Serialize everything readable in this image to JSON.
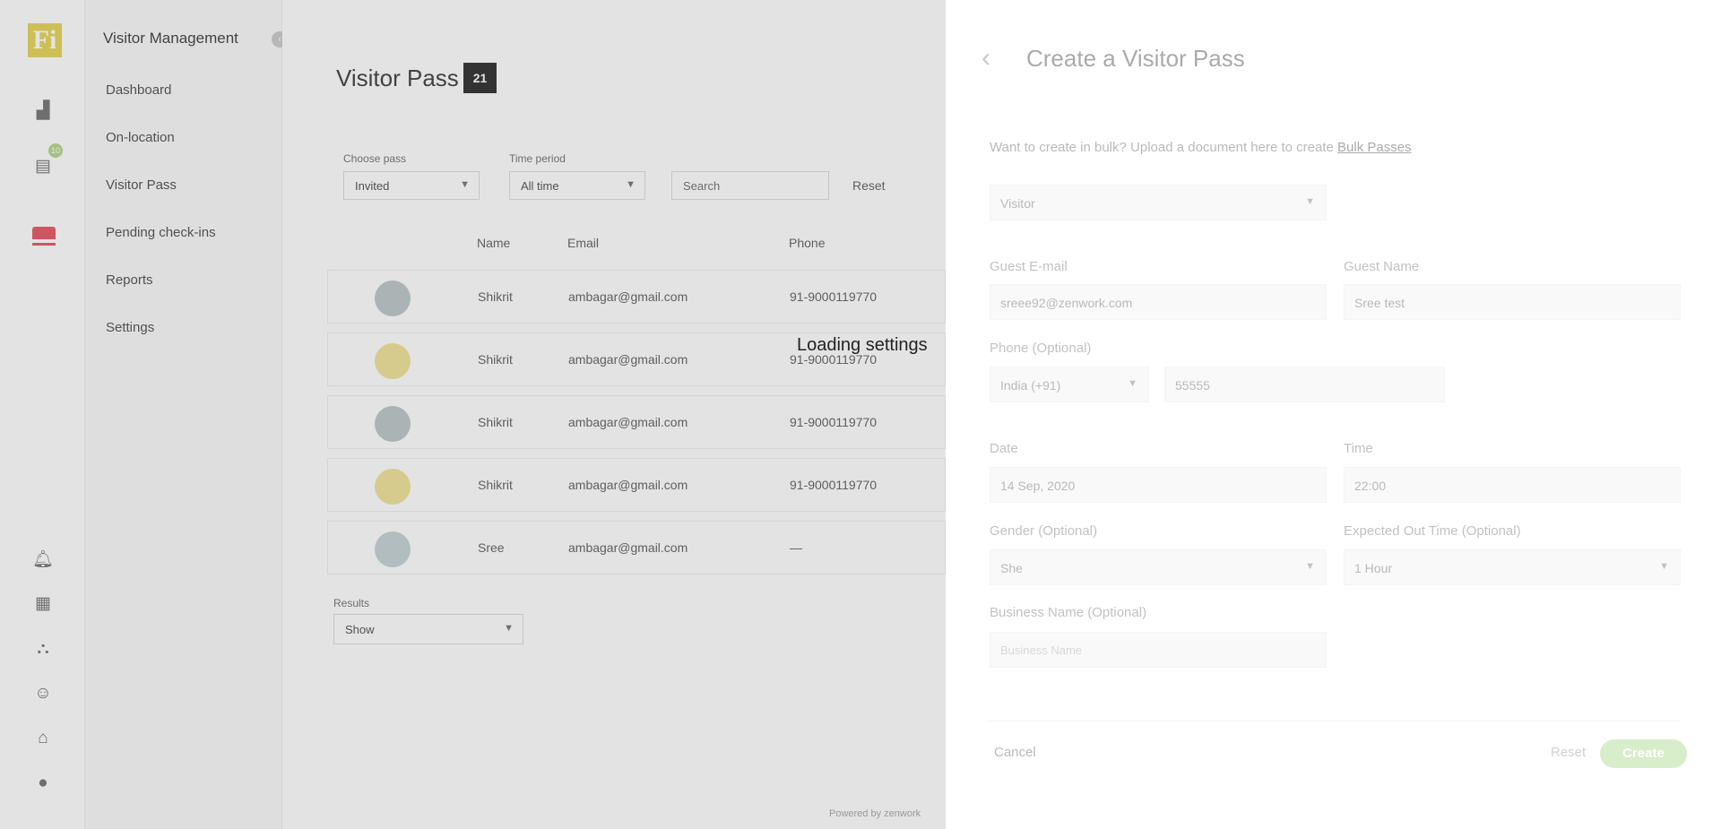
{
  "rail": {
    "logo_text": "Fi",
    "icons": [
      "building-icon",
      "calendar-icon",
      "visitor-pass-icon",
      "bell-icon",
      "grid-icon",
      "org-chart-icon",
      "user-add-icon",
      "home-icon",
      "profile-icon"
    ],
    "badge": "10"
  },
  "nav": {
    "title": "Visitor Management",
    "items": [
      "Dashboard",
      "On-location",
      "Visitor Pass",
      "Pending check-ins",
      "Reports",
      "Settings"
    ]
  },
  "main": {
    "title": "Visitor Pass",
    "count": "21",
    "filters": {
      "status_label": "Choose pass",
      "status_value": "Invited",
      "time_label": "Time period",
      "time_value": "All time",
      "search_placeholder": "Search",
      "reset": "Reset"
    },
    "columns": [
      "Name",
      "Email",
      "Phone"
    ],
    "rows": [
      {
        "name": "Shikrit",
        "email": "ambagar@gmail.com",
        "phone": "91-9000119770",
        "avatar_color": "#bfc7c9"
      },
      {
        "name": "Shikrit",
        "email": "ambagar@gmail.com",
        "phone": "91-9000119770",
        "avatar_color": "#f0e39a"
      },
      {
        "name": "Shikrit",
        "email": "ambagar@gmail.com",
        "phone": "91-9000119770",
        "avatar_color": "#bfc7c9"
      },
      {
        "name": "Shikrit",
        "email": "ambagar@gmail.com",
        "phone": "91-9000119770",
        "avatar_color": "#f0e39a"
      },
      {
        "name": "Sree",
        "email": "ambagar@gmail.com",
        "phone": "—",
        "avatar_color": "#c6d3d6"
      }
    ],
    "rows_per_page_label": "Results",
    "rows_per_page_value": "Show",
    "footer_note": "Powered by zenwork"
  },
  "loading_text": "Loading settings",
  "drawer": {
    "title": "Create a Visitor Pass",
    "bulk_prefix": "Want to create in bulk? Upload a document here to create ",
    "bulk_link": "Bulk Passes",
    "type_value": "Visitor",
    "guest_email_label": "Guest E-mail",
    "guest_email_value": "sreee92@zenwork.com",
    "guest_name_label": "Guest Name",
    "guest_name_value": "Sree test",
    "phone_label": "Phone (Optional)",
    "phone_country": "India (+91)",
    "phone_value": "55555",
    "date_label": "Date",
    "date_value": "14 Sep, 2020",
    "time_label": "Time",
    "time_value": "22:00",
    "gender_label": "Gender (Optional)",
    "gender_value": "She",
    "out_time_label": "Expected Out Time (Optional)",
    "out_time_value": "1 Hour",
    "business_label": "Business Name (Optional)",
    "business_placeholder": "Business Name",
    "cancel": "Cancel",
    "reset": "Reset",
    "create": "Create",
    "create_color": "#a9d98a"
  }
}
